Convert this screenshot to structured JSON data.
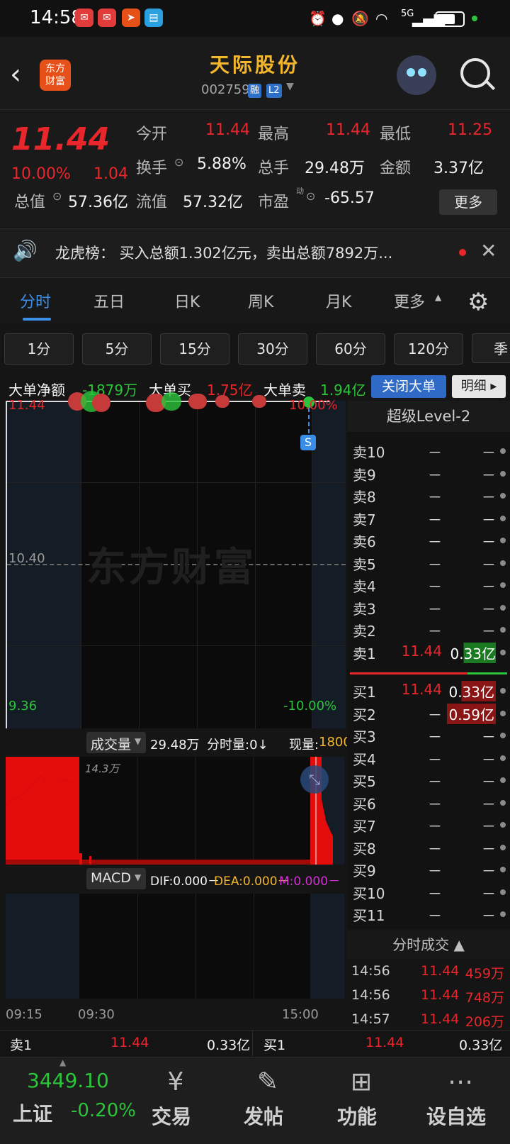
{
  "status": {
    "time": "14:58",
    "network": "5G"
  },
  "header": {
    "logo": "东方\n财富",
    "name": "天际股份",
    "code": "002759",
    "tag1": "融",
    "tag2": "L2"
  },
  "quote": {
    "price": "11.44",
    "pct": "10.00%",
    "change": "1.04",
    "open_l": "今开",
    "open_v": "11.44",
    "high_l": "最高",
    "high_v": "11.44",
    "low_l": "最低",
    "low_v": "11.25",
    "turn_l": "换手",
    "turn_v": "5.88%",
    "vol_l": "总手",
    "vol_v": "29.48万",
    "amt_l": "金额",
    "amt_v": "3.37亿",
    "mcap_l": "总值",
    "mcap_v": "57.36亿",
    "float_l": "流值",
    "float_v": "57.32亿",
    "pe_l": "市盈",
    "pe_sup": "动",
    "pe_v": "-65.57",
    "more": "更多"
  },
  "notice": {
    "text": "龙虎榜：  买入总额1.302亿元，卖出总额7892万..."
  },
  "tabs": [
    "分时",
    "五日",
    "日K",
    "周K",
    "月K",
    "更多"
  ],
  "periods": [
    "1分",
    "5分",
    "15分",
    "30分",
    "60分",
    "120分",
    "季"
  ],
  "big_order": {
    "net_l": "大单净额",
    "net_v": "-1879万",
    "buy_l": "大单买",
    "buy_v": "1.75亿",
    "sell_l": "大单卖",
    "sell_v": "1.94亿",
    "close_btn": "关闭大单",
    "detail_btn": "明细"
  },
  "chart": {
    "top_price": "11.44",
    "top_pct": "10.00%",
    "mid_price": "10.40",
    "bot_price": "9.36",
    "bot_pct": "-10.00%",
    "watermark": "东方财富",
    "s_marker": "S"
  },
  "volume": {
    "label": "成交量",
    "total": "29.48万",
    "minute": "分时量:0↓",
    "now_l": "现量:",
    "now_v": "1800",
    "max": "14.3万"
  },
  "macd": {
    "label": "MACD",
    "dif": "DIF:0.000－",
    "dea": "DEA:0.000－",
    "m": "M:0.000－"
  },
  "time_axis": [
    "09:15",
    "09:30",
    "15:00"
  ],
  "book": {
    "title": "超级Level-2",
    "asks": [
      {
        "l": "卖10",
        "p": "－",
        "v": "－"
      },
      {
        "l": "卖9",
        "p": "－",
        "v": "－"
      },
      {
        "l": "卖8",
        "p": "－",
        "v": "－"
      },
      {
        "l": "卖7",
        "p": "－",
        "v": "－"
      },
      {
        "l": "卖6",
        "p": "－",
        "v": "－"
      },
      {
        "l": "卖5",
        "p": "－",
        "v": "－"
      },
      {
        "l": "卖4",
        "p": "－",
        "v": "－"
      },
      {
        "l": "卖3",
        "p": "－",
        "v": "－"
      },
      {
        "l": "卖2",
        "p": "－",
        "v": "－"
      },
      {
        "l": "卖1",
        "p": "11.44",
        "v": "0.33亿"
      }
    ],
    "bids": [
      {
        "l": "买1",
        "p": "11.44",
        "v": "0.33亿"
      },
      {
        "l": "买2",
        "p": "－",
        "v": "0.59亿"
      },
      {
        "l": "买3",
        "p": "－",
        "v": "－"
      },
      {
        "l": "买4",
        "p": "－",
        "v": "－"
      },
      {
        "l": "买5",
        "p": "－",
        "v": "－"
      },
      {
        "l": "买6",
        "p": "－",
        "v": "－"
      },
      {
        "l": "买7",
        "p": "－",
        "v": "－"
      },
      {
        "l": "买8",
        "p": "－",
        "v": "－"
      },
      {
        "l": "买9",
        "p": "－",
        "v": "－"
      },
      {
        "l": "买10",
        "p": "－",
        "v": "－"
      },
      {
        "l": "买11",
        "p": "－",
        "v": "－"
      }
    ]
  },
  "ticks": {
    "title": "分时成交 ▲",
    "rows": [
      {
        "t": "14:56",
        "p": "11.44",
        "v": "459万"
      },
      {
        "t": "14:56",
        "p": "11.44",
        "v": "748万"
      },
      {
        "t": "14:57",
        "p": "11.44",
        "v": "206万"
      }
    ]
  },
  "strip": {
    "ask_l": "卖1",
    "ask_p": "11.44",
    "ask_v": "0.33亿",
    "bid_l": "买1",
    "bid_p": "11.44",
    "bid_v": "0.33亿"
  },
  "nav": {
    "index_v": "3449.10",
    "index_name": "上证",
    "index_pct": "-0.20%",
    "trade": "交易",
    "post": "发帖",
    "func": "功能",
    "fav": "设自选"
  },
  "colors": {
    "up": "#e8262b",
    "down": "#2bc43a",
    "accent": "#3a8ee8",
    "title": "#f3b62c"
  }
}
